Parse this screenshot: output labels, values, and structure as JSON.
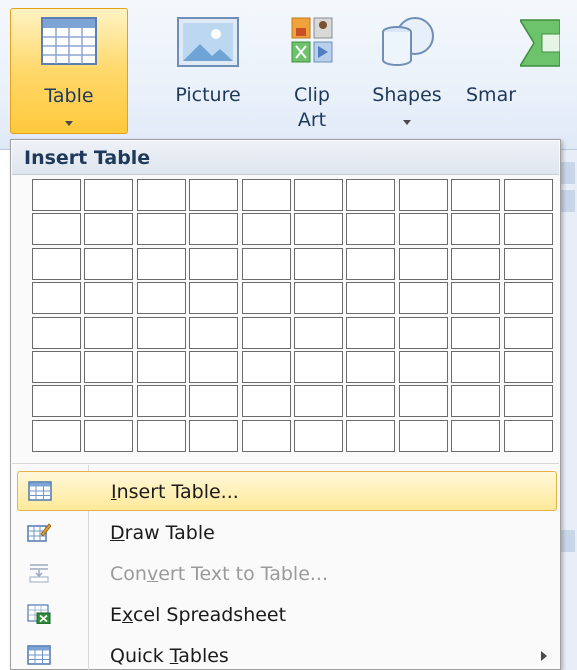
{
  "ribbon": {
    "buttons": [
      {
        "label": "Table",
        "icon": "table-icon"
      },
      {
        "label": "Picture",
        "icon": "picture-icon"
      },
      {
        "label_line1": "Clip",
        "label_line2": "Art",
        "icon": "clip-art-icon"
      },
      {
        "label": "Shapes",
        "icon": "shapes-icon"
      },
      {
        "label": "Smar",
        "icon": "smartart-icon"
      }
    ]
  },
  "insert_table_menu": {
    "header": "Insert Table",
    "grid": {
      "columns": 10,
      "rows": 8
    },
    "items": [
      {
        "pre": "",
        "accel": "I",
        "post": "nsert Table...",
        "icon": "insert-table-icon",
        "enabled": true,
        "highlighted": true
      },
      {
        "pre": "",
        "accel": "D",
        "post": "raw Table",
        "icon": "draw-table-icon",
        "enabled": true
      },
      {
        "pre": "Con",
        "accel": "v",
        "post": "ert Text to Table...",
        "icon": "convert-text-icon",
        "enabled": false
      },
      {
        "pre": "E",
        "accel": "x",
        "post": "cel Spreadsheet",
        "icon": "excel-spreadsheet-icon",
        "enabled": true
      },
      {
        "pre": "Quick ",
        "accel": "T",
        "post": "ables",
        "icon": "quick-tables-icon",
        "enabled": true,
        "submenu": true
      }
    ]
  },
  "colors": {
    "highlight": "#ffd86a",
    "highlight_border": "#e3a21a",
    "ribbon_text": "#1e395b",
    "disabled_text": "#9a9a9a"
  }
}
